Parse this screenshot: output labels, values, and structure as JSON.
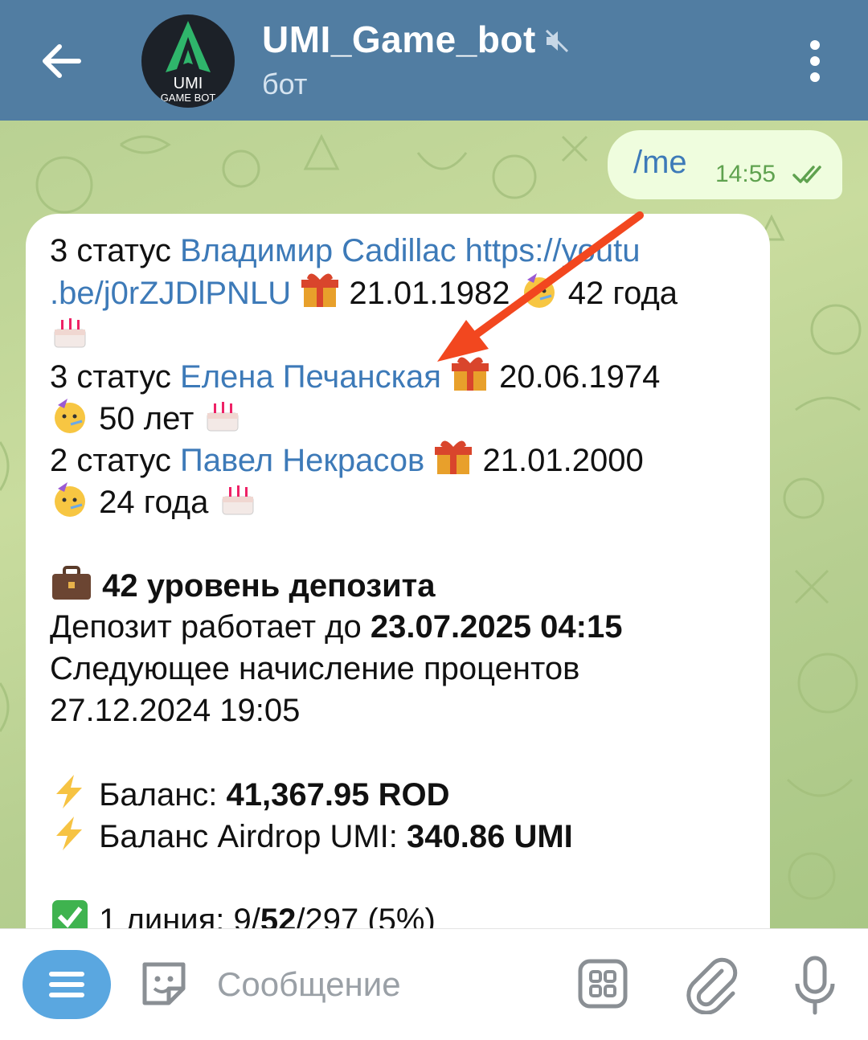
{
  "header": {
    "title": "UMI_Game_bot",
    "subtitle": "бот",
    "avatar_text_top": "UMI",
    "avatar_text_bottom": "GAME BOT",
    "accent_color": "#517da2"
  },
  "outgoing": {
    "text": "/me",
    "time": "14:55",
    "status": "read"
  },
  "incoming": {
    "lines": [
      {
        "plain": "3 статус ",
        "link": "Владимир Cadillac https://youtu"
      },
      {
        "link": ".be/j0rZJDlPNLU",
        "after": "21.01.1982",
        "after2": "42 года"
      },
      {
        "plain": "3 статус ",
        "link": "Елена Печанская",
        "after": "20.06.1974"
      },
      {
        "after": "50 лет"
      },
      {
        "plain": "2 статус ",
        "link": "Павел Некрасов",
        "after": "21.01.2000"
      },
      {
        "after": "24 года"
      }
    ],
    "deposit": {
      "level": "42 уровень депозита",
      "works_until_label": "Депозит работает до ",
      "works_until_value": "23.07.2025 04:15",
      "next_label": "Следующее начисление процентов",
      "next_value": "27.12.2024 19:05"
    },
    "balance": {
      "label": "Баланс: ",
      "value": "41,367.95 ROD",
      "airdrop_label": "Баланс Airdrop UMI: ",
      "airdrop_value": "340.86 UMI"
    },
    "line1": {
      "prefix": "1 линия: 9/",
      "bold": "52",
      "suffix": "/297 (5%)"
    }
  },
  "input": {
    "placeholder": "Сообщение"
  },
  "icons": [
    "back-arrow-icon",
    "mute-icon",
    "more-vert-icon",
    "double-check-icon",
    "gift-icon",
    "partying-face-icon",
    "cake-icon",
    "briefcase-icon",
    "lightning-icon",
    "check-box-icon",
    "menu-icon",
    "sticker-icon",
    "app-grid-icon",
    "attach-icon",
    "mic-icon"
  ],
  "colors": {
    "link": "#3d7ab8",
    "out_bubble": "#effdde",
    "chat_bg": "#b9d193",
    "arrow": "#f2471f"
  }
}
